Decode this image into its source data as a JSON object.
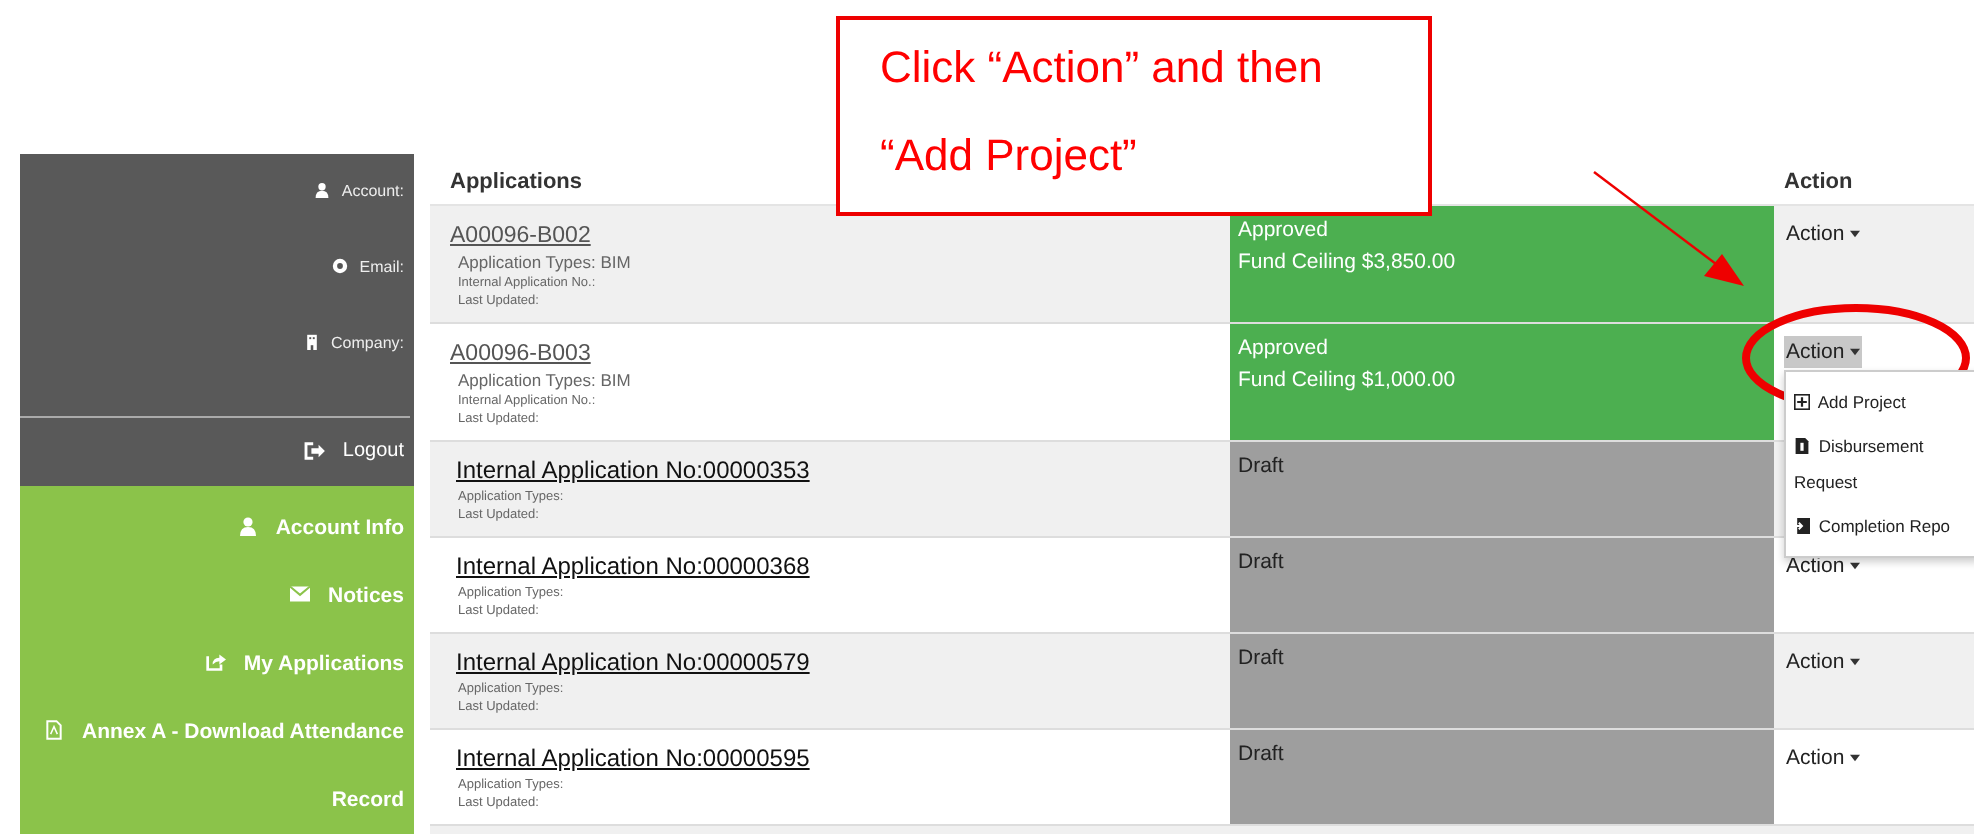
{
  "callout": {
    "text": "Click “Action” and then “Add Project”"
  },
  "sidebar": {
    "user_fields": [
      {
        "kind": "account",
        "label": "Account:"
      },
      {
        "kind": "email",
        "label": "Email:"
      },
      {
        "kind": "company",
        "label": "Company:"
      }
    ],
    "logout": {
      "label": "Logout"
    },
    "menu": [
      {
        "kind": "account",
        "label": "Account Info"
      },
      {
        "kind": "notices",
        "label": "Notices"
      },
      {
        "kind": "applications",
        "label": "My Applications"
      },
      {
        "kind": "pdf",
        "label": "Annex A - Download Attendance Record"
      }
    ]
  },
  "table": {
    "columns": [
      "Applications",
      "",
      "Action"
    ],
    "rows": [
      {
        "kind": "project",
        "title": "A00096-B002",
        "details": [
          {
            "kind": "primary",
            "text": "Application Types: BIM"
          },
          {
            "kind": "secondary",
            "text": "Internal Application No.:"
          },
          {
            "kind": "secondary",
            "text": "Last Updated:"
          }
        ],
        "status": {
          "kind": "approved",
          "lines": [
            "Approved",
            "Fund Ceiling $3,850.00"
          ]
        },
        "action": {
          "label": "Action",
          "open": false
        }
      },
      {
        "kind": "project",
        "title": "A00096-B003",
        "details": [
          {
            "kind": "primary",
            "text": "Application Types: BIM"
          },
          {
            "kind": "secondary",
            "text": "Internal Application No.:"
          },
          {
            "kind": "secondary",
            "text": "Last Updated:"
          }
        ],
        "status": {
          "kind": "approved",
          "lines": [
            "Approved",
            "Fund Ceiling $1,000.00"
          ]
        },
        "action": {
          "label": "Action",
          "open": true,
          "menu": [
            {
              "kind": "add",
              "label": "Add Project"
            },
            {
              "kind": "disbursement",
              "label": "Disbursement Request"
            },
            {
              "kind": "completion",
              "label": "Completion Repo"
            }
          ]
        }
      },
      {
        "kind": "internal",
        "title": "Internal Application No:00000353",
        "details": [
          {
            "kind": "secondary",
            "text": "Application Types:"
          },
          {
            "kind": "secondary",
            "text": "Last Updated:"
          }
        ],
        "status": {
          "kind": "draft",
          "lines": [
            "Draft"
          ]
        }
      },
      {
        "kind": "internal",
        "title": "Internal Application No:00000368",
        "details": [
          {
            "kind": "secondary",
            "text": "Application Types:"
          },
          {
            "kind": "secondary",
            "text": "Last Updated:"
          }
        ],
        "status": {
          "kind": "draft",
          "lines": [
            "Draft"
          ]
        },
        "action": {
          "label": "Action",
          "open": false
        }
      },
      {
        "kind": "internal",
        "title": "Internal Application No:00000579",
        "details": [
          {
            "kind": "secondary",
            "text": "Application Types:"
          },
          {
            "kind": "secondary",
            "text": "Last Updated:"
          }
        ],
        "status": {
          "kind": "draft",
          "lines": [
            "Draft"
          ]
        },
        "action": {
          "label": "Action",
          "open": false
        }
      },
      {
        "kind": "internal",
        "title": "Internal Application No:00000595",
        "details": [
          {
            "kind": "secondary",
            "text": "Application Types:"
          },
          {
            "kind": "secondary",
            "text": "Last Updated:"
          }
        ],
        "status": {
          "kind": "draft",
          "lines": [
            "Draft"
          ]
        },
        "action": {
          "label": "Action",
          "open": false
        }
      }
    ]
  }
}
